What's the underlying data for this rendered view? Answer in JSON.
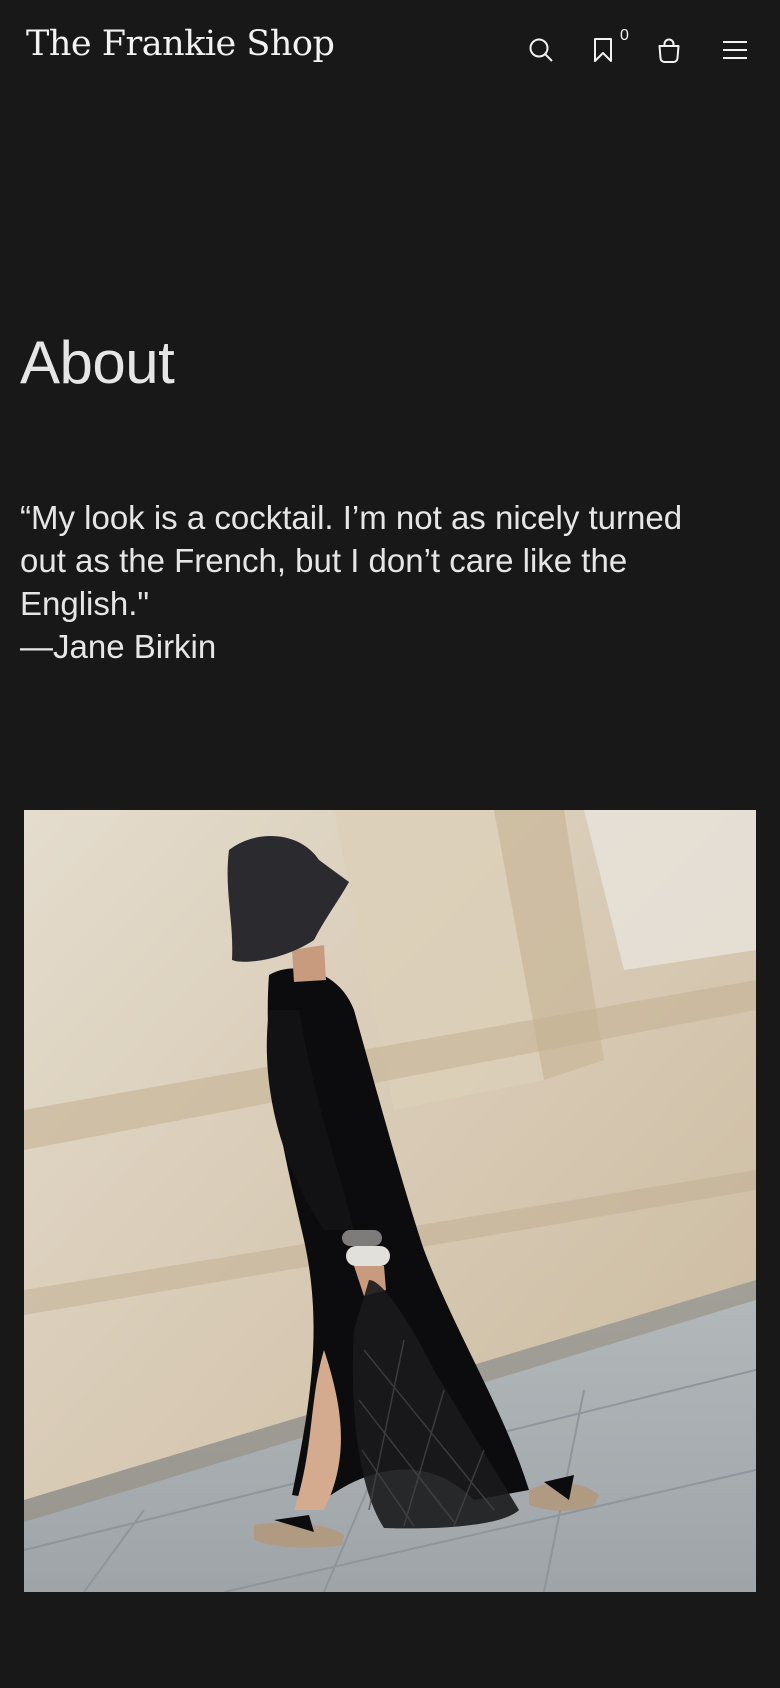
{
  "header": {
    "logo": "The Frankie Shop",
    "icons": {
      "search": "search-icon",
      "wishlist": "bookmark-icon",
      "bag": "shopping-bag-icon",
      "menu": "hamburger-menu-icon"
    },
    "wishlist_count": "0"
  },
  "main": {
    "title": "About",
    "quote": {
      "text": "“My look is a cocktail. I’m not as nicely turned out as the French, but I don’t care like the English.\"",
      "attribution": "—Jane Birkin"
    }
  },
  "colors": {
    "background": "#181818",
    "text": "#e6e6e6"
  }
}
